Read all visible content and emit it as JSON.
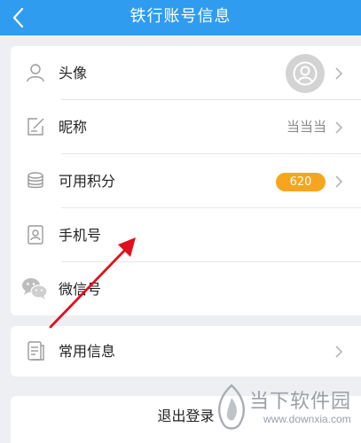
{
  "header": {
    "title": "铁行账号信息"
  },
  "profile": {
    "avatar_label": "头像",
    "nickname_label": "昵称",
    "nickname_value": "当当当",
    "points_label": "可用积分",
    "points_value": "620",
    "phone_label": "手机号",
    "wechat_label": "微信号"
  },
  "info": {
    "common_info_label": "常用信息"
  },
  "logout": {
    "label": "退出登录"
  },
  "watermark": {
    "brand": "当下软件园",
    "url": "www.downxia.com"
  },
  "colors": {
    "header": "#2f9cf0",
    "badge": "#f7a51c",
    "arrow": "#e0101c",
    "background": "#eeeff3"
  }
}
